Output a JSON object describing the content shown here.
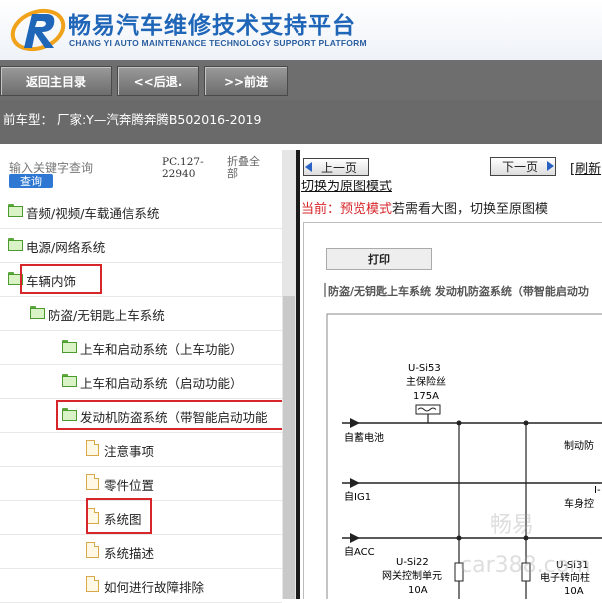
{
  "header": {
    "title_cn": "畅易汽车维修技术支持平台",
    "title_en": "CHANG YI AUTO MAINTENANCE TECHNOLOGY SUPPORT PLATFORM"
  },
  "toolbar": {
    "home_label": "返回主目录",
    "back_label": "<<后退.",
    "forward_label": ">>前进"
  },
  "vehicle": {
    "text": "前车型：  厂家:Y—汽奔腾奔腾B502016-2019"
  },
  "search": {
    "label": "输入关键字查询",
    "button": "查询",
    "pc_code": "PC.127-22940",
    "fold_all": "折叠全部"
  },
  "tree": [
    {
      "label": "音频/视频/车载通信系统",
      "type": "folder",
      "level": 0
    },
    {
      "label": "电源/网络系统",
      "type": "folder",
      "level": 0
    },
    {
      "label": "车辆内饰",
      "type": "folder",
      "level": 0
    },
    {
      "label": "防盗/无钥匙上车系统",
      "type": "folder",
      "level": 1
    },
    {
      "label": "上车和启动系统（上车功能）",
      "type": "folder",
      "level": 2
    },
    {
      "label": "上车和启动系统（启动功能）",
      "type": "folder",
      "level": 2
    },
    {
      "label": "发动机防盗系统（带智能启动功能",
      "type": "folder",
      "level": 2
    },
    {
      "label": "注意事项",
      "type": "page",
      "level": 3
    },
    {
      "label": "零件位置",
      "type": "page",
      "level": 3
    },
    {
      "label": "系统图",
      "type": "page",
      "level": 3
    },
    {
      "label": "系统描述",
      "type": "page",
      "level": 3
    },
    {
      "label": "如何进行故障排除",
      "type": "page",
      "level": 3
    }
  ],
  "viewer": {
    "prev_label": "上一页",
    "next_label": "下一页",
    "refresh_label": "[刷新",
    "switch_link": "切换为原图模式",
    "mode_prefix": "当前：预览模式",
    "mode_suffix": "若需看大图，切换至原图模",
    "print_label": "打印",
    "doc_title": "防盗/无钥匙上车系统  发动机防盗系统（带智能启动功"
  },
  "diagram": {
    "fuse_id": "U-Si53",
    "fuse_name": "主保险丝",
    "fuse_amp": "175A",
    "source1": "自蓄电池",
    "source2": "自IG1",
    "source3": "自ACC",
    "right_label1": "制动防",
    "right_label2": "I-",
    "right_label3": "车身控",
    "fuse2_id": "U-Si22",
    "fuse2_name": "网关控制单元",
    "fuse2_amp": "10A",
    "fuse3_id": "U-Si31",
    "fuse3_name": "电子转向柱",
    "fuse3_amp": "10A"
  },
  "watermark": {
    "line1": "畅易",
    "line2": "car388.com"
  },
  "colors": {
    "brand_blue": "#1f66b8",
    "highlight_red": "#d7262a",
    "toolbar_gray": "#6e6e6e",
    "search_button_blue": "#2e78d3"
  }
}
